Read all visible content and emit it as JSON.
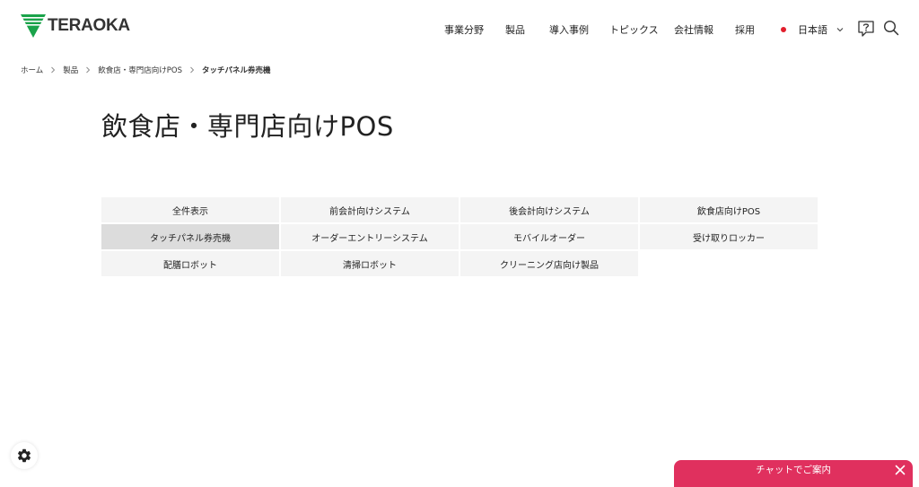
{
  "header": {
    "logo_text": "TERAOKA",
    "brand_color": "#1aa34a",
    "nav": [
      {
        "label": "事業分野"
      },
      {
        "label": "製品"
      },
      {
        "label": "導入事例"
      },
      {
        "label": "トピックス"
      },
      {
        "label": "会社情報"
      },
      {
        "label": "採用"
      }
    ],
    "language": {
      "label": "日本語",
      "flag_color": "#e21e2c"
    },
    "icons": [
      "help-icon",
      "search-icon",
      "chevron-down-icon"
    ]
  },
  "breadcrumb": {
    "items": [
      "ホーム",
      "製品",
      "飲食店・専門店向けPOS",
      "タッチパネル券売機"
    ]
  },
  "page": {
    "title": "飲食店・専門店向けPOS"
  },
  "categories": {
    "active": "タッチパネル券売機",
    "items": [
      {
        "label": "全件表示"
      },
      {
        "label": "前会計向けシステム"
      },
      {
        "label": "後会計向けシステム"
      },
      {
        "label": "飲食店向けPOS"
      },
      {
        "label": "タッチパネル券売機"
      },
      {
        "label": "オーダーエントリーシステム"
      },
      {
        "label": "モバイルオーダー"
      },
      {
        "label": "受け取りロッカー"
      },
      {
        "label": "配膳ロボット"
      },
      {
        "label": "清掃ロボット"
      },
      {
        "label": "クリーニング店向け製品"
      }
    ]
  },
  "chat": {
    "label": "チャットでご案内",
    "color": "#e0305e"
  },
  "settings": {
    "icon": "gear-icon"
  }
}
